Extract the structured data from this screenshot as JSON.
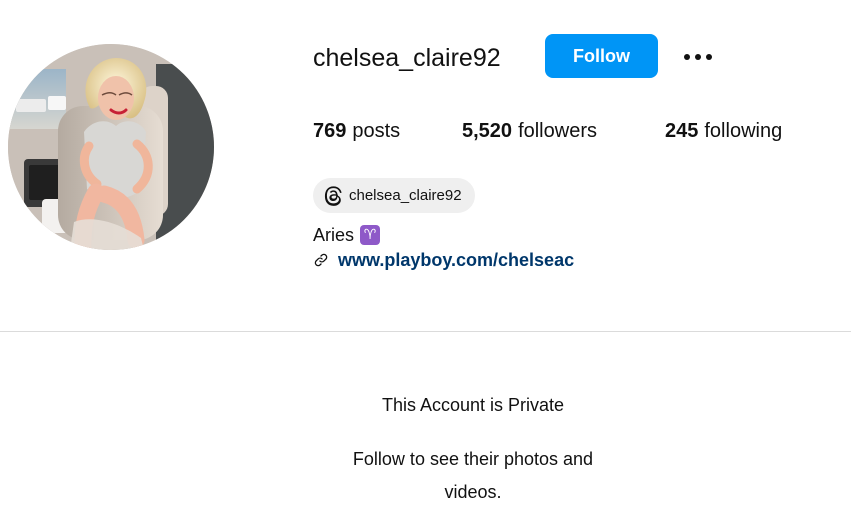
{
  "profile": {
    "username": "chelsea_claire92",
    "follow_label": "Follow",
    "more_icon": "more-options-icon",
    "stats": {
      "posts": {
        "value": "769",
        "label": "posts"
      },
      "followers": {
        "value": "5,520",
        "label": "followers"
      },
      "following": {
        "value": "245",
        "label": "following"
      }
    },
    "threads": {
      "label": "chelsea_claire92",
      "icon": "threads-icon"
    },
    "bio": {
      "text": "Aries",
      "emoji": "♈"
    },
    "website": {
      "text": "www.playboy.com/chelseac",
      "icon": "link-icon"
    }
  },
  "private_notice": {
    "title": "This Account is Private",
    "subtitle": "Follow to see their photos and videos."
  },
  "colors": {
    "follow_button": "#0095f6",
    "link": "#00376b",
    "threads_badge_bg": "#efefef",
    "divider": "#dbdbdb",
    "zodiac_badge": "#8e59c8"
  }
}
